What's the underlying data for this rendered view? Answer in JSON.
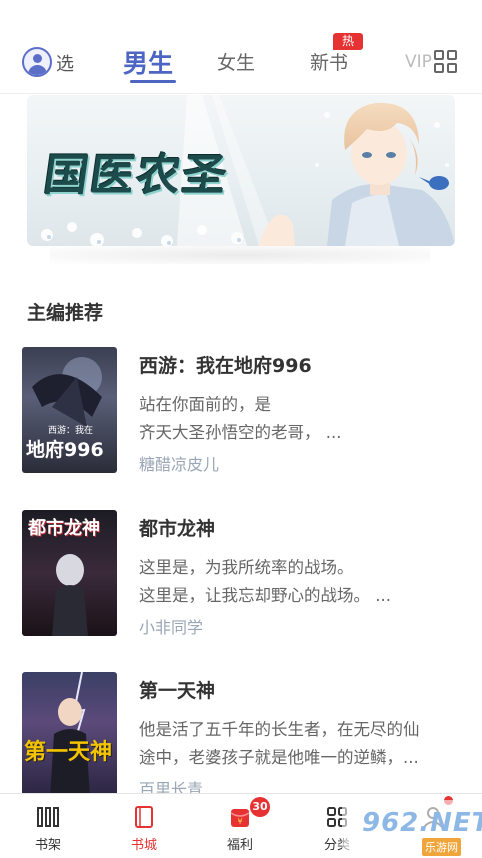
{
  "header": {
    "select_label": "选",
    "select_small": "精选",
    "tabs": [
      {
        "label": "男生",
        "active": true
      },
      {
        "label": "女生",
        "active": false
      },
      {
        "label": "新书",
        "active": false,
        "badge": "热"
      }
    ],
    "vip": "VIP",
    "accent_color": "#4d66c4"
  },
  "banner": {
    "title": "国医农圣"
  },
  "section": {
    "title": "主编推荐"
  },
  "books": [
    {
      "title": "西游：我在地府996",
      "desc": "站在你面前的，是\n齐天大圣孙悟空的老哥，…",
      "desc_line1": "站在你面前的，是",
      "desc_line2": "齐天大圣孙悟空的老哥， ...",
      "author": "糖醋凉皮儿",
      "cover_text_small": "西游：我在",
      "cover_text_big": "地府996"
    },
    {
      "title": "都市龙神",
      "desc_line1": "这里是，为我所统率的战场。",
      "desc_line2": "这里是，让我忘却野心的战场。 ...",
      "author": "小非同学",
      "cover_text_big": "都市龙神"
    },
    {
      "title": "第一天神",
      "desc_line1": "他是活了五千年的长生者，在无尽的仙",
      "desc_line2": "途中，老婆孩子就是他唯一的逆鳞，...",
      "author": "百里长青",
      "cover_text_big": "第一天神"
    }
  ],
  "bottom_nav": [
    {
      "label": "书架",
      "icon": "bookshelf-icon",
      "active": false
    },
    {
      "label": "书城",
      "icon": "book-icon",
      "active": true
    },
    {
      "label": "福利",
      "icon": "red-envelope-icon",
      "active": false,
      "badge": "30"
    },
    {
      "label": "分类",
      "icon": "category-icon",
      "active": false
    },
    {
      "label": "",
      "icon": "user-icon",
      "active": false
    }
  ],
  "watermark": {
    "text": "962.NET",
    "sub": "乐游网"
  }
}
